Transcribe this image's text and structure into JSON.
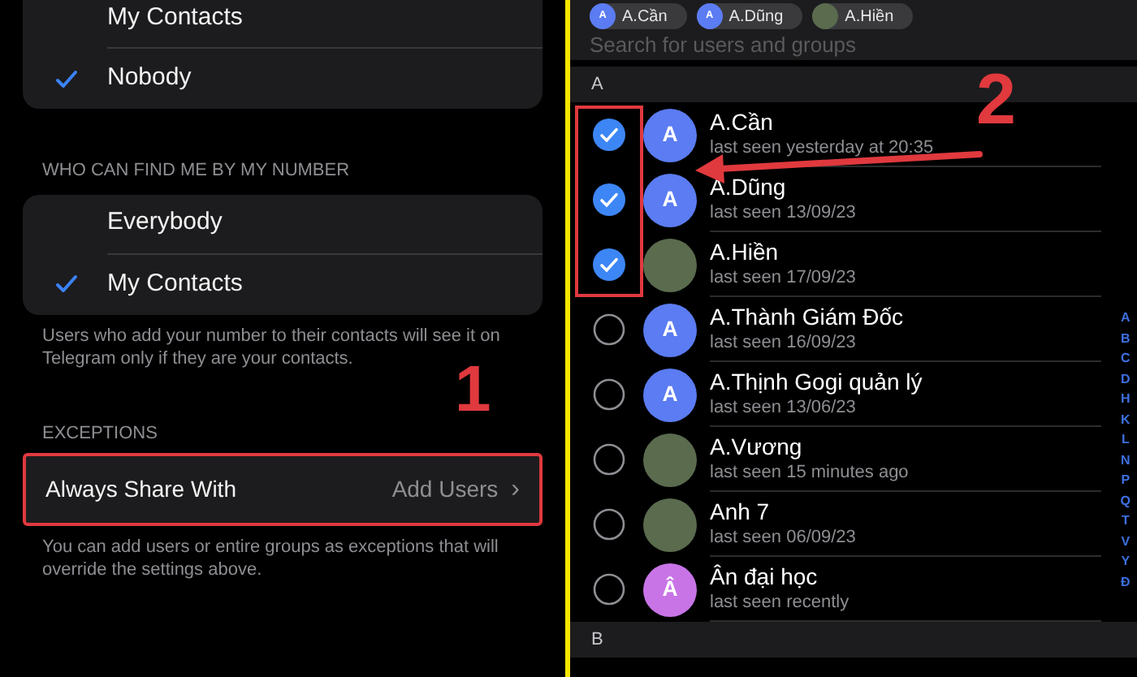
{
  "left": {
    "top_options": [
      {
        "label": "My Contacts",
        "selected": false
      },
      {
        "label": "Nobody",
        "selected": true
      }
    ],
    "find_by_number": {
      "header": "WHO CAN FIND ME BY MY NUMBER",
      "options": [
        {
          "label": "Everybody",
          "selected": false
        },
        {
          "label": "My Contacts",
          "selected": true
        }
      ],
      "footer": "Users who add your number to their contacts will see it on Telegram only if they are your contacts."
    },
    "exceptions": {
      "header": "EXCEPTIONS",
      "row": {
        "label": "Always Share With",
        "value": "Add Users",
        "chevron": "›"
      },
      "footer": "You can add users or entire groups as exceptions that will override the settings above."
    },
    "annotation": "1"
  },
  "right": {
    "chips": [
      {
        "initial": "A",
        "name": "A.Cần",
        "kind": "letter"
      },
      {
        "initial": "A",
        "name": "A.Dũng",
        "kind": "letter"
      },
      {
        "name": "A.Hiền",
        "kind": "photo"
      }
    ],
    "search": {
      "placeholder": "Search for users and groups"
    },
    "annotation": "2",
    "sections": [
      {
        "letter": "A",
        "contacts": [
          {
            "name": "A.Cần",
            "status": "last seen yesterday at 20:35",
            "kind": "letter",
            "initial": "A",
            "color": "#5b7cf2",
            "checked": true
          },
          {
            "name": "A.Dũng",
            "status": "last seen 13/09/23",
            "kind": "letter",
            "initial": "A",
            "color": "#5b7cf2",
            "checked": true
          },
          {
            "name": "A.Hiền",
            "status": "last seen 17/09/23",
            "kind": "photo",
            "checked": true
          },
          {
            "name": "A.Thành Giám Đốc",
            "status": "last seen 16/09/23",
            "kind": "letter",
            "initial": "A",
            "color": "#5b7cf2",
            "checked": false
          },
          {
            "name": "A.Thịnh Gogi quản lý",
            "status": "last seen 13/06/23",
            "kind": "letter",
            "initial": "A",
            "color": "#5b7cf2",
            "checked": false
          },
          {
            "name": "A.Vương",
            "status": "last seen 15 minutes ago",
            "kind": "photo",
            "checked": false
          },
          {
            "name": "Anh 7",
            "status": "last seen 06/09/23",
            "kind": "photo",
            "checked": false
          },
          {
            "name": "Ân đại học",
            "status": "last seen recently",
            "kind": "letter",
            "initial": "Â",
            "color": "#c874e6",
            "checked": false
          }
        ]
      },
      {
        "letter": "B"
      }
    ],
    "index": [
      "A",
      "B",
      "C",
      "D",
      "H",
      "K",
      "L",
      "N",
      "P",
      "Q",
      "T",
      "V",
      "Y",
      "Đ"
    ]
  }
}
